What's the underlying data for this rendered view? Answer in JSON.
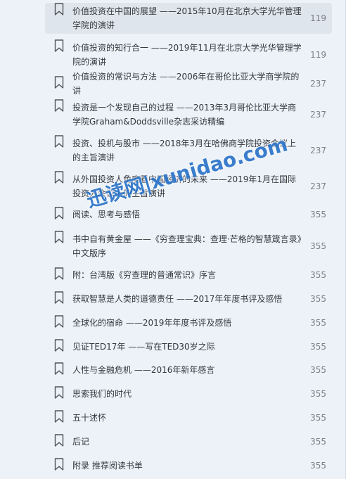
{
  "toc": {
    "items": [
      {
        "title": "价值投资在中国的展望 ——2015年10月在北京大学光华管理学院的演讲",
        "page": "119",
        "active": true
      },
      {
        "title": "价值投资的知行合一 ——2019年11月在北京大学光华管理学院的演讲",
        "page": "119",
        "active": false
      },
      {
        "title": "价值投资的常识与方法 ——2006年在哥伦比亚大学商学院的讲",
        "page": "237",
        "active": false
      },
      {
        "title": "投资是一个发现自己的过程 ——2013年3月哥伦比亚大学商学院Graham&Doddsville杂志采访精编",
        "page": "237",
        "active": false
      },
      {
        "title": "投资、投机与股市 ——2018年3月在哈佛商学院投资会议上的主旨演讲",
        "page": "237",
        "active": false
      },
      {
        "title": "从外国投资人角度看中国经济的未来 ——2019年1月在国际投资人会议上的主旨演讲",
        "page": "237",
        "active": false
      },
      {
        "title": "阅读、思考与感悟",
        "page": "355",
        "active": false
      },
      {
        "title": "书中自有黄金屋 ——《穷查理宝典：查理·芒格的智慧箴言录》中文版序",
        "page": "355",
        "active": false
      },
      {
        "title": "附：台湾版《穷查理的普通常识》序言",
        "page": "355",
        "active": false
      },
      {
        "title": "获取智慧是人类的道德责任 ——2017年年度书评及感悟",
        "page": "355",
        "active": false
      },
      {
        "title": "全球化的宿命 ——2019年年度书评及感悟",
        "page": "355",
        "active": false
      },
      {
        "title": "见证TED17年 ——写在TED30岁之际",
        "page": "355",
        "active": false
      },
      {
        "title": "人性与金融危机 ——2016年新年感言",
        "page": "355",
        "active": false
      },
      {
        "title": "思索我们的时代",
        "page": "355",
        "active": false
      },
      {
        "title": "五十述怀",
        "page": "355",
        "active": false
      },
      {
        "title": "后记",
        "page": "355",
        "active": false
      },
      {
        "title": "附录 推荐阅读书单",
        "page": "355",
        "active": false
      }
    ]
  },
  "watermark": {
    "text": "迅读网|xunidao.com"
  },
  "colors": {
    "background": "#edf2f8",
    "active_row": "#dfe5ec",
    "title_text": "#33373c",
    "page_text": "#7b8088",
    "watermark": "#2b74c9"
  },
  "icons": {
    "bookmark": "bookmark-icon"
  }
}
